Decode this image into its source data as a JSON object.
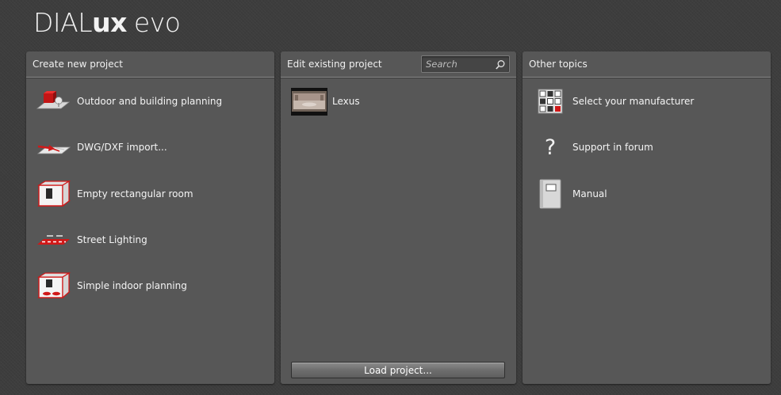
{
  "app": {
    "logo_part1": "DIAL",
    "logo_part2": "ux",
    "logo_part3": "evo"
  },
  "create_panel": {
    "title": "Create new project",
    "items": [
      {
        "label": "Outdoor and building planning",
        "icon": "outdoor-building-icon"
      },
      {
        "label": "DWG/DXF import...",
        "icon": "dwg-import-icon"
      },
      {
        "label": "Empty rectangular room",
        "icon": "empty-room-icon"
      },
      {
        "label": "Street Lighting",
        "icon": "street-lighting-icon"
      },
      {
        "label": "Simple indoor planning",
        "icon": "indoor-planning-icon"
      }
    ]
  },
  "edit_panel": {
    "title": "Edit existing project",
    "search_placeholder": "Search",
    "projects": [
      {
        "label": "Lexus"
      }
    ],
    "load_button": "Load project..."
  },
  "other_panel": {
    "title": "Other topics",
    "items": [
      {
        "label": "Select your manufacturer",
        "icon": "manufacturer-grid-icon"
      },
      {
        "label": "Support in forum",
        "icon": "question-icon"
      },
      {
        "label": "Manual",
        "icon": "manual-icon"
      }
    ]
  },
  "colors": {
    "accent_red": "#d01818",
    "panel_bg": "#575757",
    "page_bg": "#3d3d3d"
  }
}
